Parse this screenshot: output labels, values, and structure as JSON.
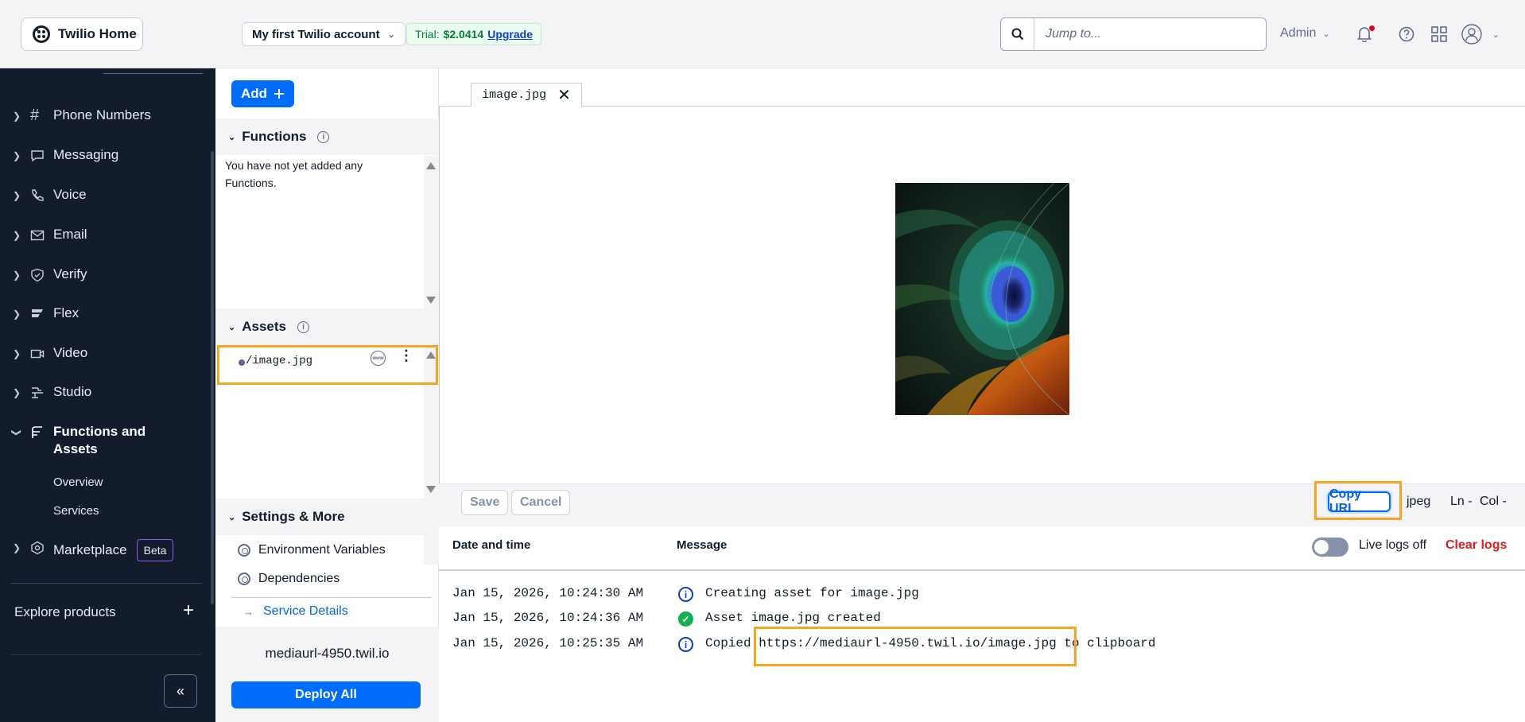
{
  "header": {
    "home_label": "Twilio Home",
    "account_name": "My first Twilio account",
    "trial_label": "Trial:",
    "trial_amount": "$2.0414",
    "upgrade_label": "Upgrade",
    "search_placeholder": "Jump to...",
    "admin_label": "Admin"
  },
  "sidebar": {
    "items": [
      {
        "label": "Phone Numbers",
        "icon": "hash-icon"
      },
      {
        "label": "Messaging",
        "icon": "chat-icon"
      },
      {
        "label": "Voice",
        "icon": "phone-icon"
      },
      {
        "label": "Email",
        "icon": "envelope-icon"
      },
      {
        "label": "Verify",
        "icon": "shield-icon"
      },
      {
        "label": "Flex",
        "icon": "flex-icon"
      },
      {
        "label": "Video",
        "icon": "video-icon"
      },
      {
        "label": "Studio",
        "icon": "studio-icon"
      },
      {
        "label": "Functions and Assets",
        "icon": "functions-icon"
      },
      {
        "label": "Marketplace",
        "icon": "marketplace-icon"
      }
    ],
    "functions_sub": [
      "Overview",
      "Services"
    ],
    "marketplace_badge": "Beta",
    "explore_label": "Explore products",
    "explore_plus": "+",
    "collapse_glyph": "«"
  },
  "file_panel": {
    "add_label": "Add",
    "functions_header": "Functions",
    "functions_empty": "You have not yet added any Functions.",
    "assets_header": "Assets",
    "asset_name": "/image.jpg",
    "asset_badge": "www",
    "settings_header": "Settings & More",
    "settings_links": [
      "Environment Variables",
      "Dependencies"
    ],
    "service_details_label": "Service Details",
    "domain": "mediaurl-4950.twil.io",
    "deploy_label": "Deploy All"
  },
  "editor": {
    "tab_label": "image.jpg",
    "save_label": "Save",
    "cancel_label": "Cancel",
    "copy_url_label": "Copy URL",
    "file_type": "jpeg",
    "ln_label": "Ln -",
    "col_label": "Col -"
  },
  "logs": {
    "col_date": "Date and time",
    "col_message": "Message",
    "live_label": "Live logs off",
    "clear_label": "Clear logs",
    "rows": [
      {
        "time": "Jan 15, 2026, 10:24:30 AM",
        "message": "Creating asset for image.jpg",
        "status": "info"
      },
      {
        "time": "Jan 15, 2026, 10:24:36 AM",
        "message": "Asset image.jpg created",
        "status": "success"
      },
      {
        "time": "Jan 15, 2026, 10:25:35 AM",
        "message": "Copied https://mediaurl-4950.twil.io/image.jpg to clipboard",
        "status": "info"
      }
    ]
  },
  "colors": {
    "accent": "#006dfa",
    "sidebar_bg": "#121c2d",
    "highlight": "#f5a623",
    "danger": "#d61f1f"
  }
}
